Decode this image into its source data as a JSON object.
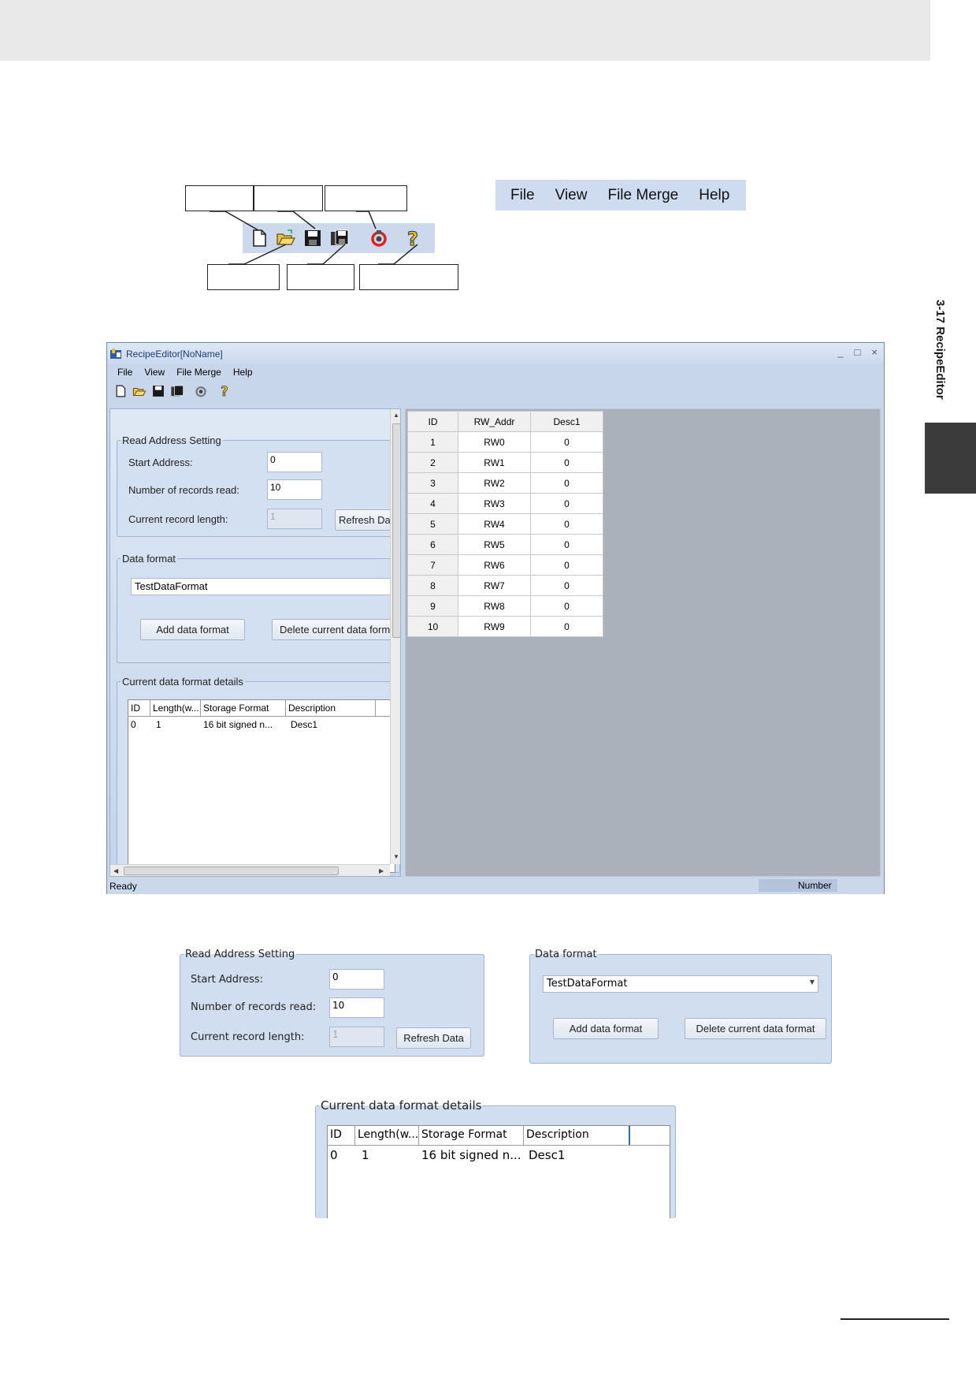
{
  "page": {
    "side_title": "3-17 RecipeEditor"
  },
  "menu_preview": {
    "items": [
      "File",
      "View",
      "File Merge",
      "Help"
    ]
  },
  "window": {
    "title": "RecipeEditor[NoName]",
    "buttons": [
      "_",
      "□",
      "×"
    ],
    "menu": [
      "File",
      "View",
      "File Merge",
      "Help"
    ],
    "toolbar_icons": [
      "new-file-icon",
      "open-folder-icon",
      "save-icon",
      "save-as-icon",
      "recycle-icon",
      "help-icon"
    ],
    "read_address_setting": {
      "legend": "Read Address Setting",
      "start_address_label": "Start Address:",
      "start_address_value": "0",
      "records_label": "Number of records read:",
      "records_value": "10",
      "record_length_label": "Current record length:",
      "record_length_value": "1",
      "refresh_button": "Refresh Data"
    },
    "data_format": {
      "legend": "Data format",
      "selected": "TestDataFormat",
      "add_button": "Add data format",
      "delete_button": "Delete current data format"
    },
    "details": {
      "legend": "Current data format details",
      "columns": [
        "ID",
        "Length(w...",
        "Storage Format",
        "Description"
      ],
      "rows": [
        [
          "0",
          "1",
          "16 bit signed n...",
          "Desc1"
        ]
      ]
    },
    "grid": {
      "columns": [
        "ID",
        "RW_Addr",
        "Desc1"
      ],
      "rows": [
        [
          "1",
          "RW0",
          "0"
        ],
        [
          "2",
          "RW1",
          "0"
        ],
        [
          "3",
          "RW2",
          "0"
        ],
        [
          "4",
          "RW3",
          "0"
        ],
        [
          "5",
          "RW4",
          "0"
        ],
        [
          "6",
          "RW5",
          "0"
        ],
        [
          "7",
          "RW6",
          "0"
        ],
        [
          "8",
          "RW7",
          "0"
        ],
        [
          "9",
          "RW8",
          "0"
        ],
        [
          "10",
          "RW9",
          "0"
        ]
      ]
    },
    "status": {
      "left": "Ready",
      "right": "Number"
    }
  },
  "colors": {
    "window_bg": "#c7d6ea",
    "grid_bg": "#abb1ba",
    "title_text": "#1d3a7a"
  }
}
